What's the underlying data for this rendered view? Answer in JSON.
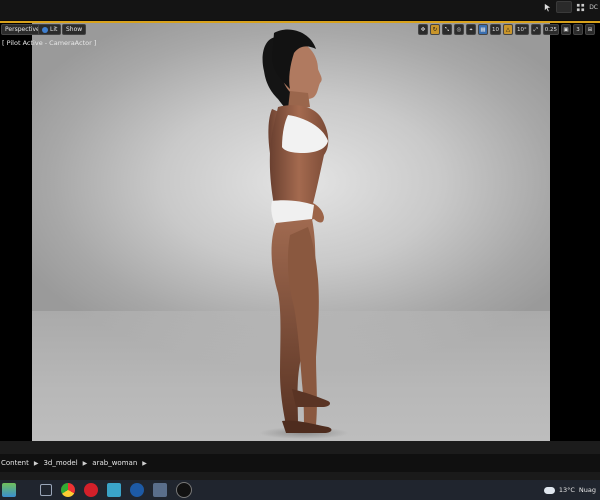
{
  "window": {
    "tray_text": "DC"
  },
  "viewport": {
    "perspective_label": "Perspective",
    "lit_label": "Lit",
    "show_label": "Show",
    "pilot_label": "[ Pilot Active - CameraActor ]",
    "snap_grid_value": "10",
    "snap_rotation_value": "10°",
    "scale_value": "0.25",
    "camera_speed": "3"
  },
  "content_browser": {
    "breadcrumbs": [
      "Content",
      "3d_model",
      "arab_woman"
    ]
  },
  "taskbar": {
    "weather_temp": "13°C",
    "weather_text": "Nuag"
  },
  "colors": {
    "accent": "#d8a21c",
    "viewport_bg": "#c9c9c9"
  }
}
